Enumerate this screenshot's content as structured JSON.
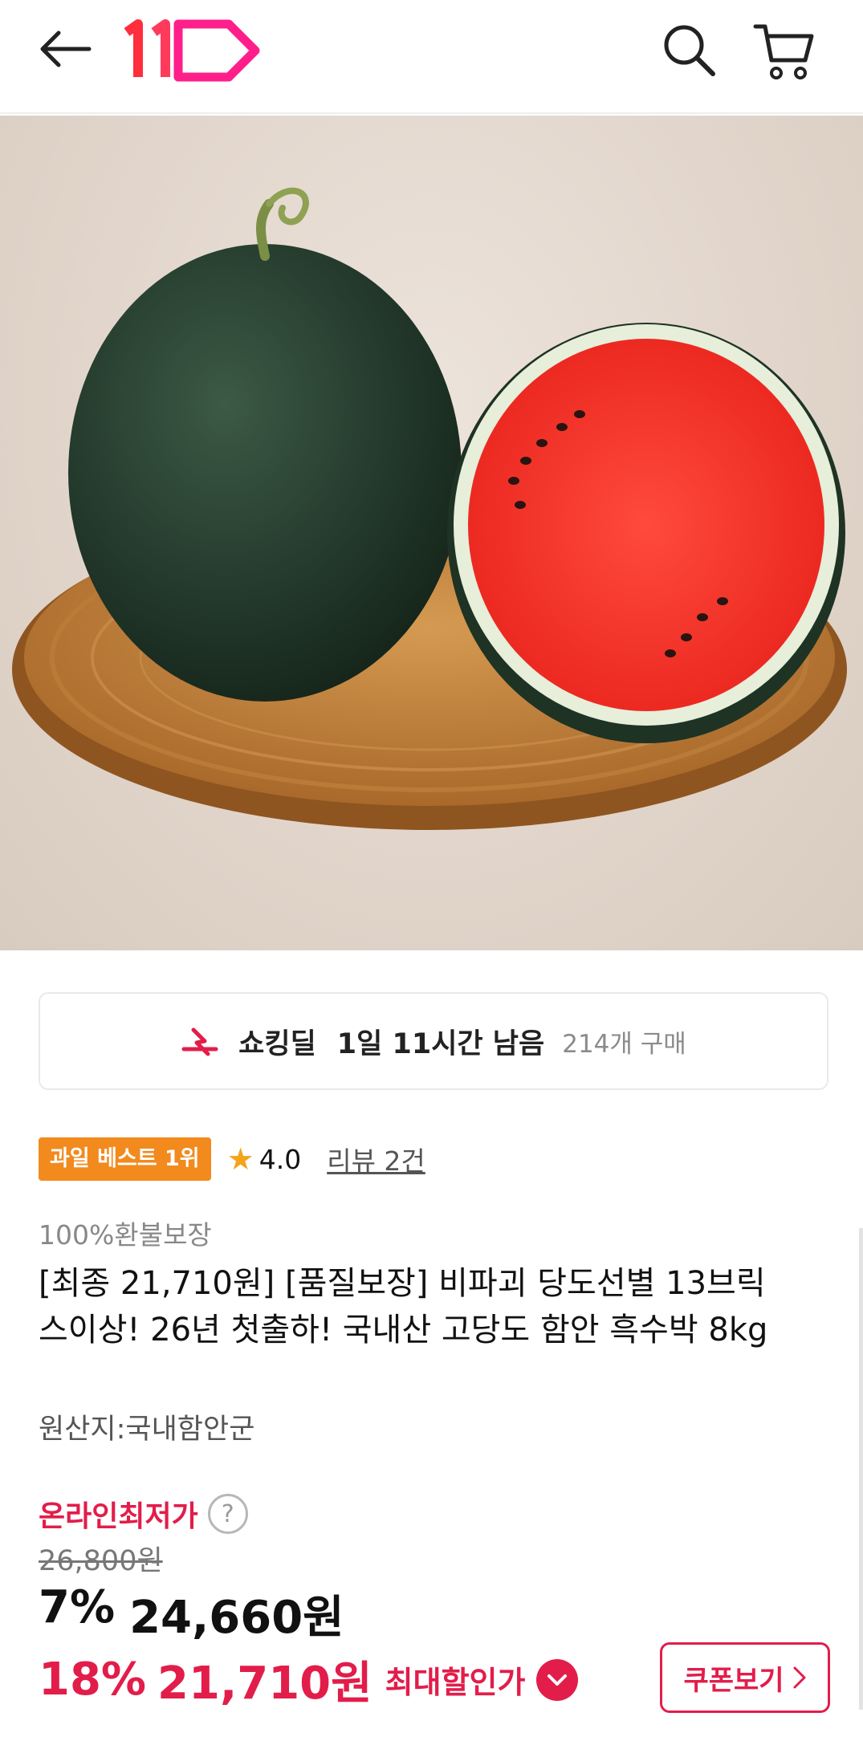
{
  "header": {
    "icons": {
      "back": "back-arrow-icon",
      "logo": "11st-logo",
      "search": "search-icon",
      "cart": "cart-icon"
    },
    "brand_color": "#e21d4a"
  },
  "gallery": {
    "slide_count": 4,
    "active_index": 0
  },
  "deal": {
    "label": "쇼킹딜",
    "time_left": "1일 11시간 남음",
    "purchase_count": "214개 구매"
  },
  "badges": {
    "best": "과일 베스트 1위",
    "rating": "4.0",
    "review": "리뷰 2건"
  },
  "product": {
    "refund": "100%환불보장",
    "title": "[최종 21,710원] [품질보장] 비파괴 당도선별 13브릭스이상! 26년 첫출하! 국내산 고당도 함안 흑수박 8kg",
    "origin": "원산지:국내함안군"
  },
  "price": {
    "lowest_label": "온라인최저가",
    "help_glyph": "?",
    "original": "26,800원",
    "discount_pct": "7%",
    "sale_price": "24,660원",
    "max_pct": "18%",
    "max_price": "21,710원",
    "max_label": "최대할인가",
    "coupon_button": "쿠폰보기",
    "accent": "#e21d4a",
    "badge_color": "#f28a1e"
  }
}
